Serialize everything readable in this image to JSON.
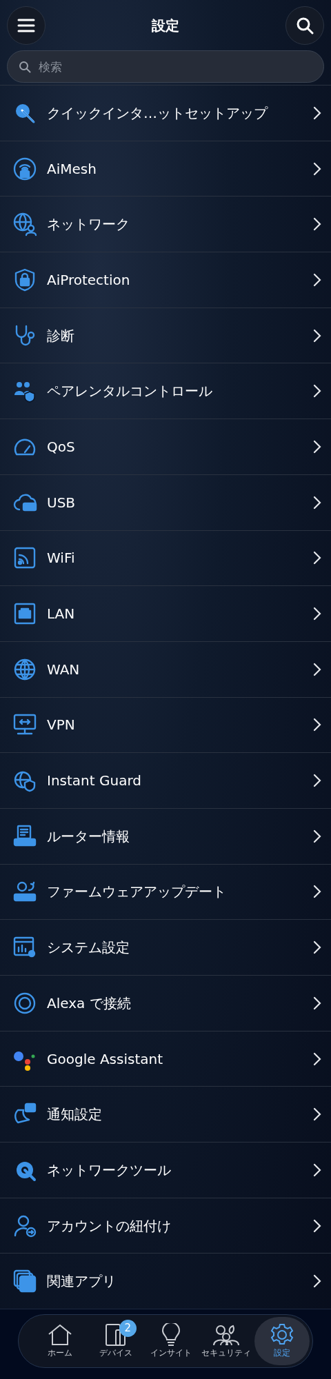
{
  "header": {
    "title": "設定"
  },
  "search": {
    "placeholder": "検索"
  },
  "items": [
    {
      "label": "クイックインタ…ットセットアップ"
    },
    {
      "label": "AiMesh"
    },
    {
      "label": "ネットワーク"
    },
    {
      "label": "AiProtection"
    },
    {
      "label": "診断"
    },
    {
      "label": "ペアレンタルコントロール"
    },
    {
      "label": "QoS"
    },
    {
      "label": "USB"
    },
    {
      "label": "WiFi"
    },
    {
      "label": "LAN"
    },
    {
      "label": "WAN"
    },
    {
      "label": "VPN"
    },
    {
      "label": "Instant Guard"
    },
    {
      "label": "ルーター情報"
    },
    {
      "label": "ファームウェアアップデート"
    },
    {
      "label": "システム設定"
    },
    {
      "label": "Alexa で接続"
    },
    {
      "label": "Google Assistant"
    },
    {
      "label": "通知設定"
    },
    {
      "label": "ネットワークツール"
    },
    {
      "label": "アカウントの紐付け"
    },
    {
      "label": "関連アプリ"
    }
  ],
  "tab_bar": [
    {
      "label": "ホーム",
      "selected": false
    },
    {
      "label": "デバイス",
      "selected": false,
      "badge": "2"
    },
    {
      "label": "インサイト",
      "selected": false
    },
    {
      "label": "セキュリティ",
      "selected": false
    },
    {
      "label": "設定",
      "selected": true
    }
  ]
}
